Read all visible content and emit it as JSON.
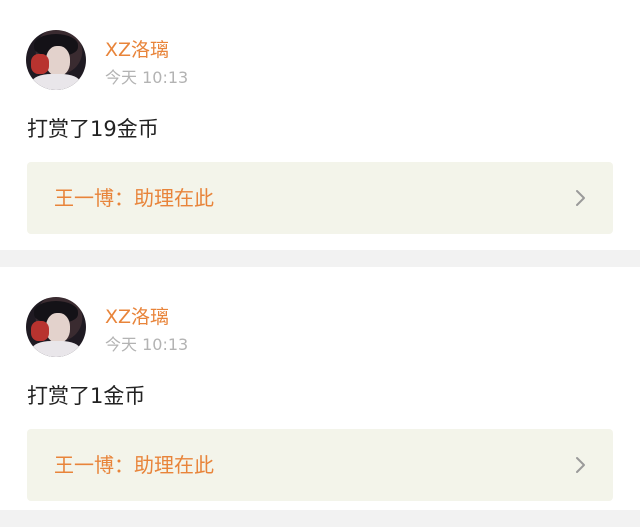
{
  "posts": [
    {
      "username": "XZ洛璃",
      "time": "今天 10:13",
      "message": "打赏了19金币",
      "link": "王一博：助理在此"
    },
    {
      "username": "XZ洛璃",
      "time": "今天 10:13",
      "message": "打赏了1金币",
      "link": "王一博：助理在此"
    }
  ],
  "icons": {
    "avatar": "user-avatar-photo",
    "chevron": "chevron-right-icon"
  },
  "colors": {
    "username": "#e8843a",
    "link_text": "#e8843a",
    "link_bg": "#f3f4ea",
    "time": "#b3b3b3",
    "message": "#222222",
    "separator": "#f2f2f2"
  }
}
